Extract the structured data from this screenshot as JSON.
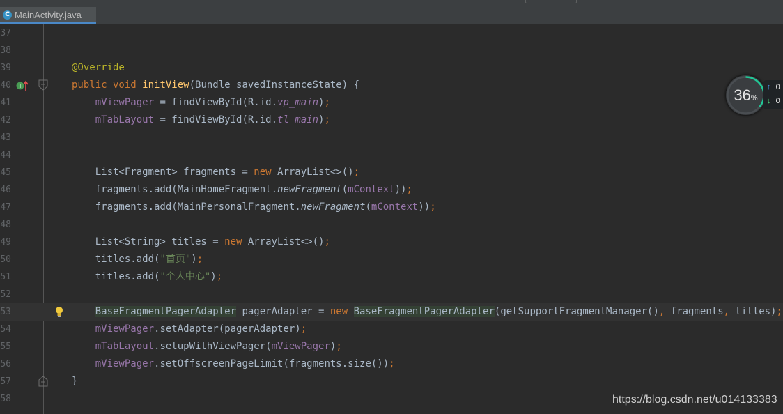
{
  "editor": {
    "tab_label": "MainActivity.java",
    "tab_icon": "C",
    "lines": [
      {
        "num": "37",
        "tokens": []
      },
      {
        "num": "38",
        "tokens": []
      },
      {
        "num": "39",
        "tokens": [
          {
            "t": "@Override",
            "c": "an"
          }
        ]
      },
      {
        "num": "40",
        "tokens": [
          {
            "t": "public void ",
            "c": "kw"
          },
          {
            "t": "initView",
            "c": "fn"
          },
          {
            "t": "(Bundle savedInstanceState) {"
          }
        ]
      },
      {
        "num": "41",
        "tokens": [
          {
            "t": "    "
          },
          {
            "t": "mViewPager",
            "c": "fld"
          },
          {
            "t": " = findViewById(R.id."
          },
          {
            "t": "vp_main",
            "c": "fld it"
          },
          {
            "t": ")"
          },
          {
            "t": ";",
            "c": "kw"
          }
        ]
      },
      {
        "num": "42",
        "tokens": [
          {
            "t": "    "
          },
          {
            "t": "mTabLayout",
            "c": "fld"
          },
          {
            "t": " = findViewById(R.id."
          },
          {
            "t": "tl_main",
            "c": "fld it"
          },
          {
            "t": ")"
          },
          {
            "t": ";",
            "c": "kw"
          }
        ]
      },
      {
        "num": "43",
        "tokens": []
      },
      {
        "num": "44",
        "tokens": []
      },
      {
        "num": "45",
        "tokens": [
          {
            "t": "    List<Fragment> fragments = "
          },
          {
            "t": "new ",
            "c": "kw"
          },
          {
            "t": "ArrayList<>()"
          },
          {
            "t": ";",
            "c": "kw"
          }
        ]
      },
      {
        "num": "46",
        "tokens": [
          {
            "t": "    fragments.add(MainHomeFragment."
          },
          {
            "t": "newFragment",
            "c": "it"
          },
          {
            "t": "("
          },
          {
            "t": "mContext",
            "c": "fld"
          },
          {
            "t": "))"
          },
          {
            "t": ";",
            "c": "kw"
          }
        ]
      },
      {
        "num": "47",
        "tokens": [
          {
            "t": "    fragments.add(MainPersonalFragment."
          },
          {
            "t": "newFragment",
            "c": "it"
          },
          {
            "t": "("
          },
          {
            "t": "mContext",
            "c": "fld"
          },
          {
            "t": "))"
          },
          {
            "t": ";",
            "c": "kw"
          }
        ]
      },
      {
        "num": "48",
        "tokens": []
      },
      {
        "num": "49",
        "tokens": [
          {
            "t": "    List<String> titles = "
          },
          {
            "t": "new ",
            "c": "kw"
          },
          {
            "t": "ArrayList<>()"
          },
          {
            "t": ";",
            "c": "kw"
          }
        ]
      },
      {
        "num": "50",
        "tokens": [
          {
            "t": "    titles.add("
          },
          {
            "t": "\"首页\"",
            "c": "str"
          },
          {
            "t": ")"
          },
          {
            "t": ";",
            "c": "kw"
          }
        ]
      },
      {
        "num": "51",
        "tokens": [
          {
            "t": "    titles.add("
          },
          {
            "t": "\"个人中心\"",
            "c": "str"
          },
          {
            "t": ")"
          },
          {
            "t": ";",
            "c": "kw"
          }
        ]
      },
      {
        "num": "52",
        "tokens": []
      },
      {
        "num": "53",
        "tokens": [
          {
            "t": "    "
          },
          {
            "t": "BaseFragmentPagerAdapter",
            "c": "hl"
          },
          {
            "t": " pagerAdapter = "
          },
          {
            "t": "new ",
            "c": "kw"
          },
          {
            "t": "BaseFragmentPagerAdapter",
            "c": "hl"
          },
          {
            "t": "(getSupportFragmentManager()"
          },
          {
            "t": ", ",
            "c": "kw"
          },
          {
            "t": "fragments"
          },
          {
            "t": ", ",
            "c": "kw"
          },
          {
            "t": "titles)"
          },
          {
            "t": ";",
            "c": "kw"
          }
        ]
      },
      {
        "num": "54",
        "tokens": [
          {
            "t": "    "
          },
          {
            "t": "mViewPager",
            "c": "fld"
          },
          {
            "t": ".setAdapter(pagerAdapter)"
          },
          {
            "t": ";",
            "c": "kw"
          }
        ]
      },
      {
        "num": "55",
        "tokens": [
          {
            "t": "    "
          },
          {
            "t": "mTabLayout",
            "c": "fld"
          },
          {
            "t": ".setupWithViewPager("
          },
          {
            "t": "mViewPager",
            "c": "fld"
          },
          {
            "t": ")"
          },
          {
            "t": ";",
            "c": "kw"
          }
        ]
      },
      {
        "num": "56",
        "tokens": [
          {
            "t": "    "
          },
          {
            "t": "mViewPager",
            "c": "fld"
          },
          {
            "t": ".setOffscreenPageLimit(fragments.size())"
          },
          {
            "t": ";",
            "c": "kw"
          }
        ]
      },
      {
        "num": "57",
        "tokens": [
          {
            "t": "}"
          }
        ]
      },
      {
        "num": "58",
        "tokens": []
      }
    ]
  },
  "widget": {
    "value": "36",
    "unit": "%",
    "percent": 36,
    "upload_char": "0",
    "download_char": "0",
    "up_arrow": "↑",
    "down_arrow": "↓"
  },
  "watermark": "https://blog.csdn.net/u014133383",
  "colors": {
    "background": "#2b2b2b",
    "keyword": "#cc7832",
    "annotation": "#bbb529",
    "method": "#ffc66d",
    "field": "#9876aa",
    "string": "#6a8759",
    "tab_underline": "#4a88c7",
    "progress_ring": "#20c997"
  },
  "icons": {
    "line_40_gutter": [
      "override-marker-icon",
      "fold-icon"
    ],
    "line_53_gutter": "intention-bulb-icon",
    "line_57_gutter": "fold-end-icon"
  }
}
